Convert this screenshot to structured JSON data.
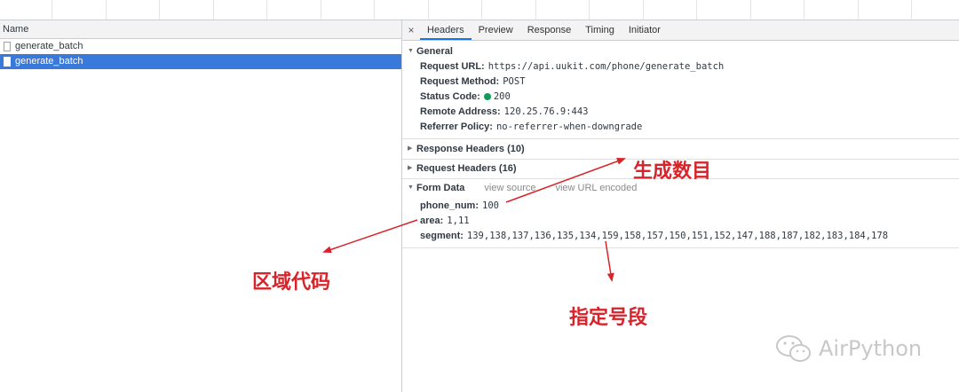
{
  "left_panel": {
    "column_header": "Name",
    "requests": [
      {
        "name": "generate_batch",
        "selected": false
      },
      {
        "name": "generate_batch",
        "selected": true
      }
    ]
  },
  "tabs": {
    "close": "×",
    "items": [
      "Headers",
      "Preview",
      "Response",
      "Timing",
      "Initiator"
    ],
    "active": "Headers"
  },
  "general": {
    "title": "General",
    "request_url_label": "Request URL:",
    "request_url": "https://api.uukit.com/phone/generate_batch",
    "method_label": "Request Method:",
    "method": "POST",
    "status_label": "Status Code:",
    "status": "200",
    "remote_label": "Remote Address:",
    "remote": "120.25.76.9:443",
    "referrer_label": "Referrer Policy:",
    "referrer": "no-referrer-when-downgrade"
  },
  "response_headers": "Response Headers (10)",
  "request_headers": "Request Headers (16)",
  "form_data": {
    "title": "Form Data",
    "view_source": "view source",
    "view_url_encoded": "view URL encoded",
    "phone_num_label": "phone_num:",
    "phone_num": "100",
    "area_label": "area:",
    "area": "1,11",
    "segment_label": "segment:",
    "segment": "139,138,137,136,135,134,159,158,157,150,151,152,147,188,187,182,183,184,178"
  },
  "annotations": {
    "generate_count": "生成数目",
    "area_code": "区域代码",
    "segment": "指定号段"
  },
  "watermark": "AirPython",
  "colors": {
    "annotation": "#d8232a",
    "selected_row": "#3879d9",
    "status_ok": "#0f9d58"
  }
}
